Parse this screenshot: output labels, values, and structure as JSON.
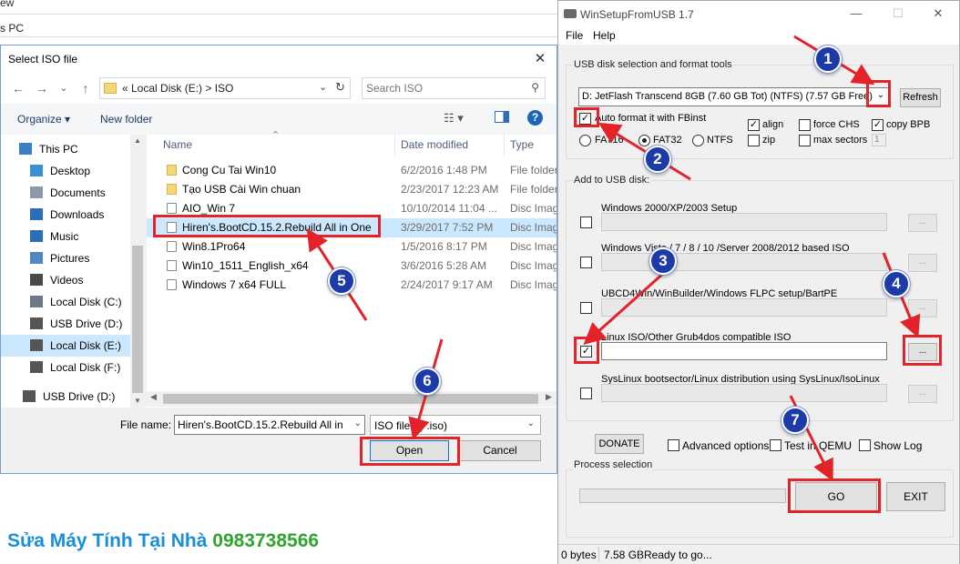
{
  "background_window": {
    "partial_menu": "ew",
    "partial_title": "s PC"
  },
  "iso_dialog": {
    "title": "Select ISO file",
    "close_glyph": "✕",
    "nav": {
      "back": "←",
      "forward": "→",
      "recent": "⌄",
      "up": "↑"
    },
    "address": {
      "text": "«  Local Disk (E:)  >  ISO",
      "dropdown": "⌄",
      "refresh": "↻"
    },
    "search": {
      "placeholder": "Search ISO",
      "icon": "⚲"
    },
    "commands": {
      "organize": "Organize ▾",
      "new_folder": "New folder",
      "view": "☷ ▾",
      "help": "?"
    },
    "nav_pane": [
      {
        "label": "This PC",
        "icon": "pc-icon",
        "color": "#3c7fc6"
      },
      {
        "label": "Desktop",
        "icon": "desktop-icon",
        "color": "#3a8fd9"
      },
      {
        "label": "Documents",
        "icon": "documents-icon",
        "color": "#8a9aab"
      },
      {
        "label": "Downloads",
        "icon": "downloads-icon",
        "color": "#2a6fb8"
      },
      {
        "label": "Music",
        "icon": "music-icon",
        "color": "#2a6fb8"
      },
      {
        "label": "Pictures",
        "icon": "pictures-icon",
        "color": "#4f86c4"
      },
      {
        "label": "Videos",
        "icon": "videos-icon",
        "color": "#4a4a4a"
      },
      {
        "label": "Local Disk (C:)",
        "icon": "drive-c-icon",
        "color": "#6d7b88"
      },
      {
        "label": "USB Drive (D:)",
        "icon": "usb-drive-icon",
        "color": "#555555"
      },
      {
        "label": "Local Disk (E:)",
        "icon": "drive-icon",
        "color": "#555555",
        "selected": true
      },
      {
        "label": "Local Disk (F:)",
        "icon": "drive-icon",
        "color": "#555555"
      },
      {
        "label": "USB Drive (D:)",
        "icon": "usb-drive-icon",
        "color": "#555555"
      }
    ],
    "columns": {
      "name": "Name",
      "date": "Date modified",
      "type": "Type",
      "sort_glyph": "⌃"
    },
    "files": [
      {
        "name": "Cong Cu Tai Win10",
        "date": "6/2/2016 1:48 PM",
        "type": "File folder",
        "kind": "folder"
      },
      {
        "name": "Tạo USB Cài Win chuan",
        "date": "2/23/2017 12:23 AM",
        "type": "File folder",
        "kind": "folder"
      },
      {
        "name": "AIO_Win 7",
        "date": "10/10/2014 11:04 ...",
        "type": "Disc Image",
        "kind": "disc"
      },
      {
        "name": "Hiren's.BootCD.15.2.Rebuild All in One",
        "date": "3/29/2017 7:52 PM",
        "type": "Disc Image",
        "kind": "disc",
        "selected": true
      },
      {
        "name": "Win8.1Pro64",
        "date": "1/5/2016 8:17 PM",
        "type": "Disc Image",
        "kind": "disc"
      },
      {
        "name": "Win10_1511_English_x64",
        "date": "3/6/2016 5:28 AM",
        "type": "Disc Image",
        "kind": "disc"
      },
      {
        "name": "Windows 7 x64 FULL",
        "date": "2/24/2017 9:17 AM",
        "type": "Disc Image",
        "kind": "disc"
      }
    ],
    "file_name_label": "File name:",
    "file_name_value": "Hiren's.BootCD.15.2.Rebuild All in",
    "file_type": "ISO files (*.iso)",
    "open_label": "Open",
    "cancel_label": "Cancel"
  },
  "wsu": {
    "title": "WinSetupFromUSB 1.7",
    "controls": {
      "minimize": "—",
      "maximize": "☐",
      "close": "✕"
    },
    "menu": {
      "file": "File",
      "help": "Help"
    },
    "usb_group_title": "USB disk selection and format tools",
    "usb_disk": "D: JetFlash Transcend 8GB (7.60 GB Tot) (NTFS) (7.57 GB Free)",
    "refresh_label": "Refresh",
    "auto_format": "Auto format it with FBinst",
    "check_mark": "✓",
    "options": {
      "align": "align",
      "force_chs": "force CHS",
      "copy_bpb": "copy BPB",
      "zip": "zip",
      "max_sectors": "max sectors",
      "max_sectors_value": "1",
      "fat16": "FAT16",
      "fat32": "FAT32",
      "ntfs": "NTFS"
    },
    "add_group_title": "Add to USB disk:",
    "sources": [
      {
        "label": "Windows 2000/XP/2003 Setup",
        "checked": false,
        "active": false
      },
      {
        "label": "Windows Vista / 7 / 8 / 10 /Server 2008/2012 based ISO",
        "checked": false,
        "active": false
      },
      {
        "label": "UBCD4Win/WinBuilder/Windows FLPC setup/BartPE",
        "checked": false,
        "active": false
      },
      {
        "label": "Linux ISO/Other Grub4dos compatible ISO",
        "checked": true,
        "active": true
      },
      {
        "label": "SysLinux bootsector/Linux distribution using SysLinux/IsoLinux",
        "checked": false,
        "active": false
      }
    ],
    "browse_label": "...",
    "donate_label": "DONATE",
    "advanced_options": "Advanced options",
    "test_qemu": "Test in QEMU",
    "show_log": "Show Log",
    "process_group_title": "Process selection",
    "go_label": "GO",
    "exit_label": "EXIT",
    "status": {
      "bytes": "0 bytes",
      "size": "7.58 GB",
      "message": "Ready to go..."
    }
  },
  "annotations": {
    "badges": [
      "1",
      "2",
      "3",
      "4",
      "5",
      "6",
      "7"
    ],
    "highlight_color": "#e3222a",
    "badge_color": "#1d3ba8"
  },
  "watermark": {
    "part1": "Sửa Máy Tính Tại Nhà",
    "part2": "0983738566"
  }
}
